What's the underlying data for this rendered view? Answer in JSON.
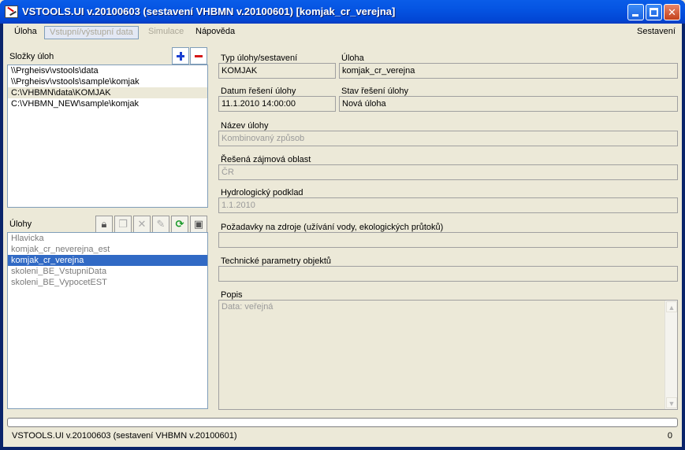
{
  "window": {
    "title": "VSTOOLS.UI v.20100603 (sestavení VHBMN v.20100601) [komjak_cr_verejna]",
    "title_color": "#0554e2"
  },
  "menu": {
    "items": [
      "Úloha",
      "Vstupní/výstupní data",
      "Simulace",
      "Nápověda"
    ],
    "right": "Sestavení"
  },
  "folders": {
    "label": "Složky úloh",
    "add_icon": "plus-icon",
    "remove_icon": "minus-icon",
    "items": [
      "\\\\Prgheisv\\vstools\\data",
      "\\\\Prgheisv\\vstools\\sample\\komjak",
      "C:\\VHBMN\\data\\KOMJAK",
      "C:\\VHBMN_NEW\\sample\\komjak"
    ],
    "highlighted_index": 2
  },
  "tasks": {
    "label": "Úlohy",
    "toolbar_icons": [
      "lock-icon",
      "copy-icon",
      "delete-icon",
      "rename-icon",
      "refresh-icon",
      "save-icon"
    ],
    "items": [
      "Hlavicka",
      "komjak_cr_neverejna_est",
      "komjak_cr_verejna",
      "skoleni_BE_VstupniData",
      "skoleni_BE_VypocetEST"
    ],
    "selected_index": 2
  },
  "details": {
    "type_label": "Typ úlohy/sestavení",
    "type_value": "KOMJAK",
    "task_label": "Úloha",
    "task_value": "komjak_cr_verejna",
    "date_label": "Datum řešení úlohy",
    "date_value": "11.1.2010 14:00:00",
    "state_label": "Stav řešení úlohy",
    "state_value": "Nová úloha",
    "name_label": "Název úlohy",
    "name_value": "Kombinovaný způsob",
    "area_label": "Řešená zájmová oblast",
    "area_value": "ČR",
    "hydro_label": "Hydrologický podklad",
    "hydro_value": "1.1.2010",
    "demands_label": "Požadavky na zdroje (užívání vody, ekologických průtoků)",
    "demands_value": "",
    "tech_label": "Technické parametry objektů",
    "tech_value": "",
    "desc_label": "Popis",
    "desc_value": "Data: veřejná"
  },
  "status": {
    "text": "VSTOOLS.UI v.20100603 (sestavení VHBMN v.20100601)",
    "count": "0",
    "progress": 0
  }
}
